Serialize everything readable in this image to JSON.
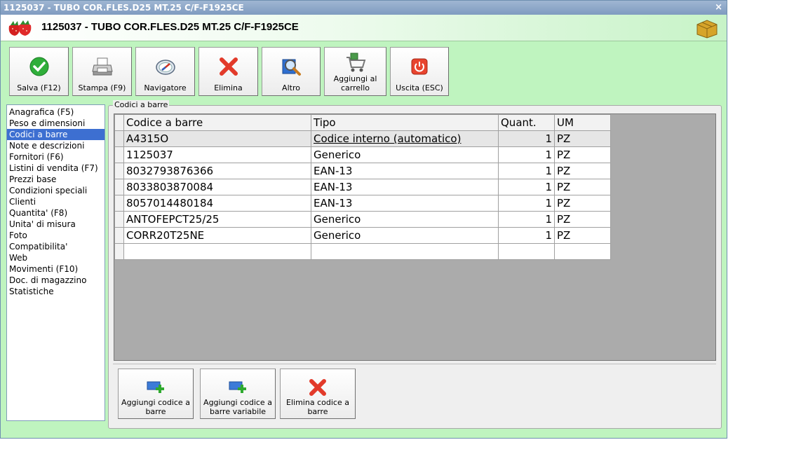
{
  "window": {
    "title": "1125037 - TUBO COR.FLES.D25 MT.25 C/F-F1925CE",
    "close_glyph": "×"
  },
  "header": {
    "title": "1125037 - TUBO COR.FLES.D25 MT.25 C/F-F1925CE",
    "logo_icon": "strawberry-logo",
    "right_icon": "boxes-icon"
  },
  "toolbar": {
    "save": "Salva (F12)",
    "print": "Stampa (F9)",
    "navigator": "Navigatore",
    "delete": "Elimina",
    "other": "Altro",
    "add_to_cart": "Aggiungi al carrello",
    "exit": "Uscita (ESC)"
  },
  "sidebar": {
    "items": [
      "Anagrafica (F5)",
      "Peso e dimensioni",
      "Codici a barre",
      "Note e descrizioni",
      "Fornitori (F6)",
      "Listini di vendita (F7)",
      "Prezzi base",
      "Condizioni speciali",
      "Clienti",
      "Quantita' (F8)",
      "Unita' di misura",
      "Foto",
      "Compatibilita'",
      "Web",
      "Movimenti (F10)",
      "Doc. di magazzino",
      "Statistiche"
    ],
    "selected_index": 2
  },
  "barcodes": {
    "group_label": "Codici a barre",
    "columns": [
      "Codice a barre",
      "Tipo",
      "Quant.",
      "UM"
    ],
    "rows": [
      {
        "code": "A4315O",
        "type": "Codice interno (automatico)",
        "qty": "1",
        "um": "PZ"
      },
      {
        "code": "1125037",
        "type": "Generico",
        "qty": "1",
        "um": "PZ"
      },
      {
        "code": "8032793876366",
        "type": "EAN-13",
        "qty": "1",
        "um": "PZ"
      },
      {
        "code": "8033803870084",
        "type": "EAN-13",
        "qty": "1",
        "um": "PZ"
      },
      {
        "code": "8057014480184",
        "type": "EAN-13",
        "qty": "1",
        "um": "PZ"
      },
      {
        "code": "ANTOFEPCT25/25",
        "type": "Generico",
        "qty": "1",
        "um": "PZ"
      },
      {
        "code": "CORR20T25NE",
        "type": "Generico",
        "qty": "1",
        "um": "PZ"
      },
      {
        "code": "",
        "type": "",
        "qty": "",
        "um": ""
      }
    ]
  },
  "actions": {
    "add_barcode": "Aggiungi codice a barre",
    "add_variable_barcode": "Aggiungi codice a barre variabile",
    "delete_barcode": "Elimina codice a barre"
  }
}
